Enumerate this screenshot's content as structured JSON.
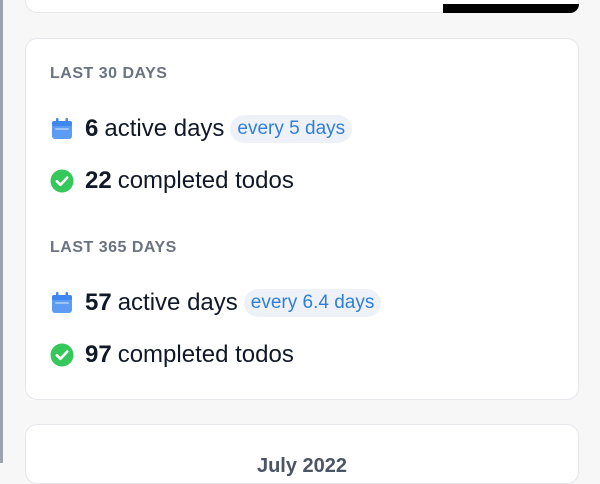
{
  "last30": {
    "label": "LAST 30 DAYS",
    "active_count": "6",
    "active_text": "active days",
    "frequency": "every 5 days",
    "completed_count": "22",
    "completed_text": "completed todos"
  },
  "last365": {
    "label": "LAST 365 DAYS",
    "active_count": "57",
    "active_text": "active days",
    "frequency": "every 6.4 days",
    "completed_count": "97",
    "completed_text": "completed todos"
  },
  "calendar": {
    "month_title": "July 2022"
  },
  "colors": {
    "calendar_icon": "#5c9cf5",
    "check_icon": "#34c759",
    "pill_bg": "#eef2f8",
    "pill_text": "#2f7fd8"
  },
  "icons": {
    "active": "calendar-icon",
    "completed": "check-circle-icon"
  }
}
